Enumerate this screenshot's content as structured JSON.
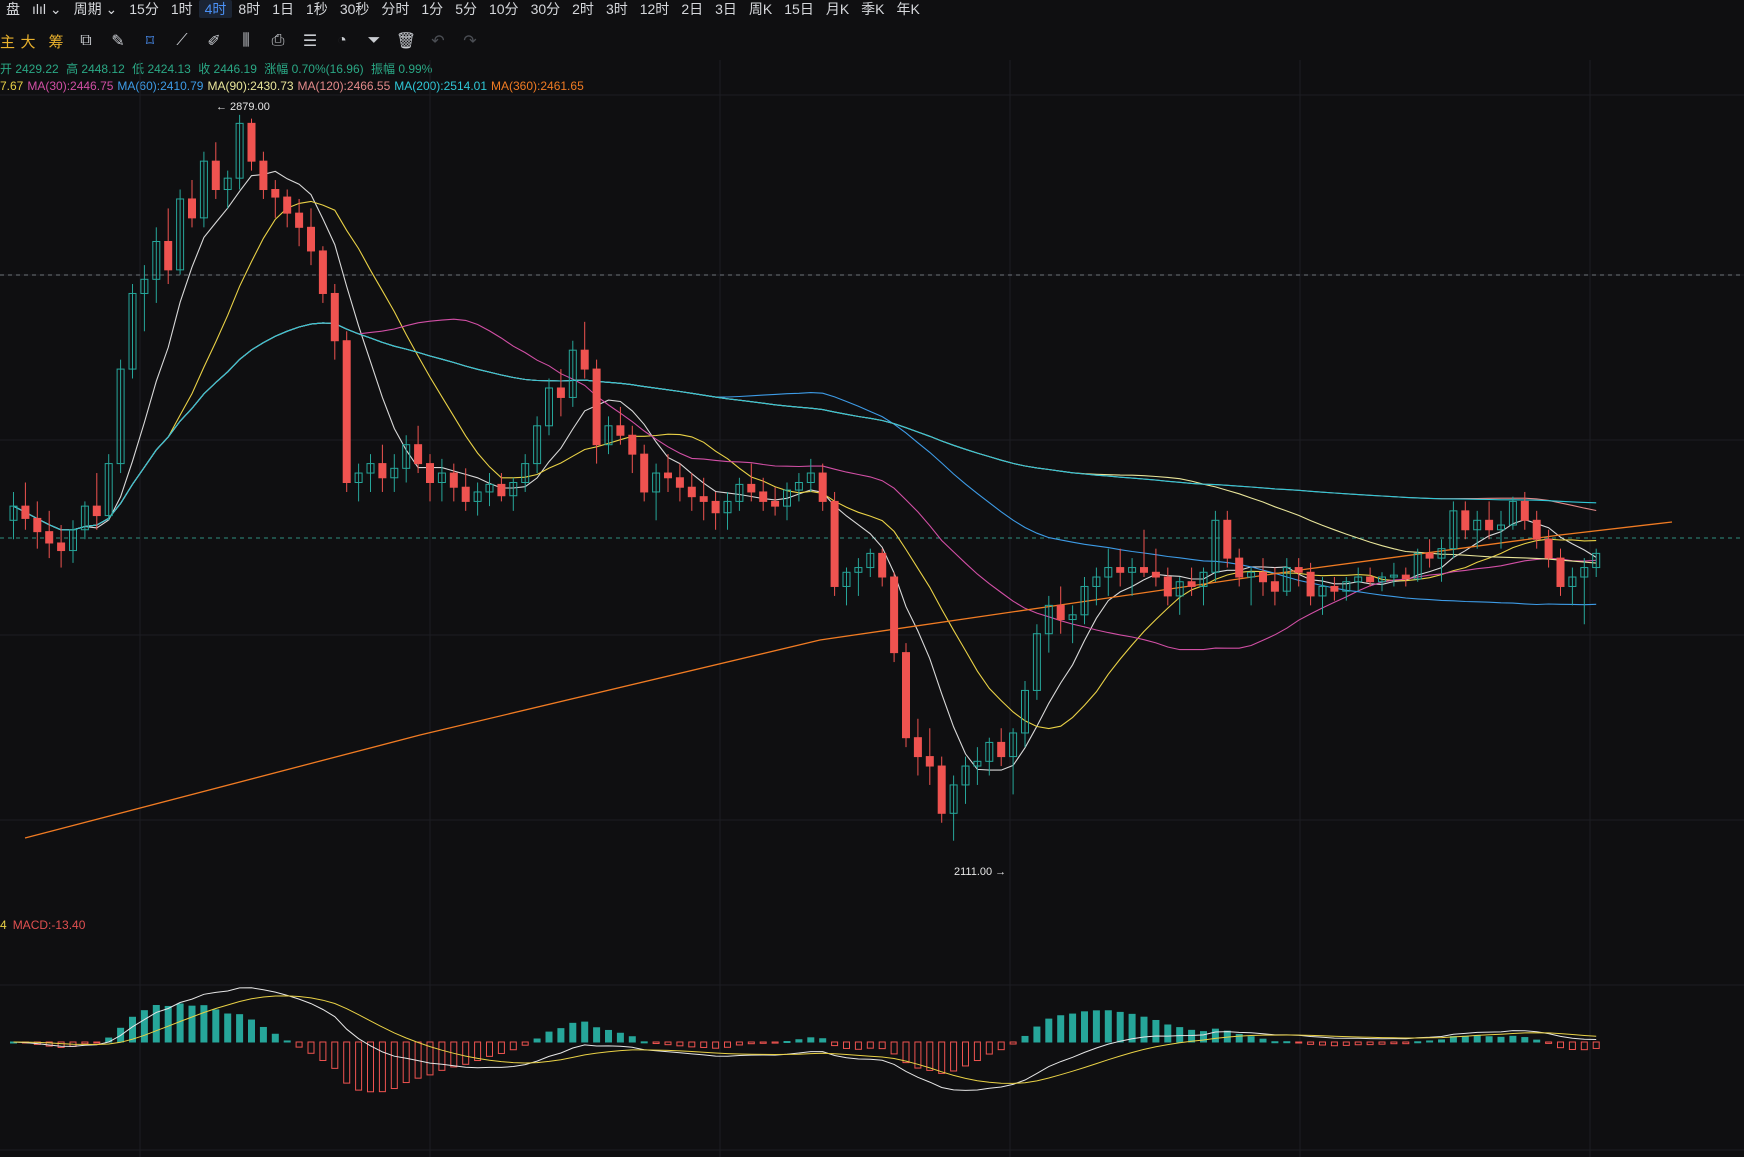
{
  "topbar": {
    "items": [
      {
        "label": "盘",
        "active": false
      },
      {
        "label": "ılıl ⌄",
        "active": false
      },
      {
        "label": "周期 ⌄",
        "active": false
      },
      {
        "label": "15分",
        "active": false
      },
      {
        "label": "1时",
        "active": false
      },
      {
        "label": "4时",
        "active": true
      },
      {
        "label": "8时",
        "active": false
      },
      {
        "label": "1日",
        "active": false
      },
      {
        "label": "1秒",
        "active": false
      },
      {
        "label": "30秒",
        "active": false
      },
      {
        "label": "分时",
        "active": false
      },
      {
        "label": "1分",
        "active": false
      },
      {
        "label": "5分",
        "active": false
      },
      {
        "label": "10分",
        "active": false
      },
      {
        "label": "30分",
        "active": false
      },
      {
        "label": "2时",
        "active": false
      },
      {
        "label": "3时",
        "active": false
      },
      {
        "label": "12时",
        "active": false
      },
      {
        "label": "2日",
        "active": false
      },
      {
        "label": "3日",
        "active": false
      },
      {
        "label": "周K",
        "active": false
      },
      {
        "label": "15日",
        "active": false
      },
      {
        "label": "月K",
        "active": false
      },
      {
        "label": "季K",
        "active": false
      },
      {
        "label": "年K",
        "active": false
      }
    ]
  },
  "toolbar": {
    "words": [
      "主",
      "大",
      "筹"
    ],
    "tools": [
      {
        "name": "crosshair-tool-icon",
        "glyph": "⧉",
        "active": false
      },
      {
        "name": "draw-tool-icon",
        "glyph": "✎",
        "active": false
      },
      {
        "name": "select-tool-icon",
        "glyph": "⌑",
        "active": true
      },
      {
        "name": "ruler-icon",
        "glyph": "⟋",
        "active": false
      },
      {
        "name": "brush-icon",
        "glyph": "✐",
        "active": false
      },
      {
        "name": "indicator-icon",
        "glyph": "⫼",
        "active": false
      },
      {
        "name": "lock-icon",
        "glyph": "⎙",
        "active": false
      },
      {
        "name": "note-icon",
        "glyph": "☰",
        "active": false
      },
      {
        "name": "magnet-icon",
        "glyph": "◔",
        "active": false
      },
      {
        "name": "filter-icon",
        "glyph": "⏷",
        "active": false
      },
      {
        "name": "trash-icon",
        "glyph": "🗑",
        "active": false
      },
      {
        "name": "undo-icon",
        "glyph": "↶",
        "active": false,
        "dim": true
      },
      {
        "name": "redo-icon",
        "glyph": "↷",
        "active": false,
        "dim": true
      }
    ]
  },
  "ohlc": {
    "open": "开 2429.22",
    "high": "高 2448.12",
    "low": "低 2424.13",
    "close": "收 2446.19",
    "change": "涨幅 0.70%(16.96)",
    "amplitude": "振幅 0.99%"
  },
  "ma_legend": [
    {
      "label": "7.67",
      "color": "#e9d146"
    },
    {
      "label": "MA(30):2446.75",
      "color": "#d14fa5"
    },
    {
      "label": "MA(60):2410.79",
      "color": "#3d9be6"
    },
    {
      "label": "MA(90):2430.73",
      "color": "#e9e59a"
    },
    {
      "label": "MA(120):2466.55",
      "color": "#e38a8a"
    },
    {
      "label": "MA(200):2514.01",
      "color": "#2fc7d6"
    },
    {
      "label": "MA(360):2461.65",
      "color": "#f07b23"
    }
  ],
  "macd_legend": [
    {
      "label": "4",
      "color": "#e9d146"
    },
    {
      "label": "MACD:-13.40",
      "color": "#e05050"
    }
  ],
  "annotations": {
    "high": "← 2879.00",
    "low": "2111.00 →"
  },
  "colors": {
    "up": "#26a69a",
    "down": "#ef5350",
    "bg": "#0f0f11",
    "grid": "#1c1e22"
  },
  "chart_data": {
    "type": "candlestick",
    "timeframe": "4时",
    "high_marker": 2879.0,
    "low_marker": 2111.0,
    "candles": [
      [
        2450,
        2480,
        2430,
        2465
      ],
      [
        2465,
        2490,
        2440,
        2452
      ],
      [
        2452,
        2470,
        2420,
        2438
      ],
      [
        2438,
        2460,
        2410,
        2426
      ],
      [
        2426,
        2445,
        2400,
        2418
      ],
      [
        2418,
        2450,
        2405,
        2440
      ],
      [
        2440,
        2470,
        2430,
        2465
      ],
      [
        2465,
        2500,
        2440,
        2455
      ],
      [
        2455,
        2520,
        2450,
        2510
      ],
      [
        2510,
        2620,
        2500,
        2610
      ],
      [
        2610,
        2700,
        2600,
        2690
      ],
      [
        2690,
        2720,
        2650,
        2705
      ],
      [
        2705,
        2760,
        2680,
        2745
      ],
      [
        2745,
        2780,
        2700,
        2715
      ],
      [
        2715,
        2800,
        2710,
        2790
      ],
      [
        2790,
        2810,
        2760,
        2770
      ],
      [
        2770,
        2840,
        2760,
        2830
      ],
      [
        2830,
        2850,
        2790,
        2800
      ],
      [
        2800,
        2820,
        2780,
        2812
      ],
      [
        2812,
        2879,
        2800,
        2870
      ],
      [
        2870,
        2875,
        2820,
        2830
      ],
      [
        2830,
        2840,
        2790,
        2800
      ],
      [
        2800,
        2810,
        2770,
        2792
      ],
      [
        2792,
        2800,
        2760,
        2775
      ],
      [
        2775,
        2790,
        2740,
        2760
      ],
      [
        2760,
        2780,
        2720,
        2735
      ],
      [
        2735,
        2740,
        2680,
        2690
      ],
      [
        2690,
        2700,
        2620,
        2640
      ],
      [
        2640,
        2650,
        2480,
        2490
      ],
      [
        2490,
        2510,
        2470,
        2500
      ],
      [
        2500,
        2520,
        2480,
        2510
      ],
      [
        2510,
        2530,
        2480,
        2495
      ],
      [
        2495,
        2520,
        2480,
        2505
      ],
      [
        2505,
        2540,
        2490,
        2530
      ],
      [
        2530,
        2550,
        2500,
        2510
      ],
      [
        2510,
        2520,
        2470,
        2490
      ],
      [
        2490,
        2515,
        2470,
        2500
      ],
      [
        2500,
        2510,
        2470,
        2485
      ],
      [
        2485,
        2505,
        2460,
        2470
      ],
      [
        2470,
        2490,
        2455,
        2480
      ],
      [
        2480,
        2500,
        2465,
        2488
      ],
      [
        2488,
        2500,
        2470,
        2476
      ],
      [
        2476,
        2495,
        2460,
        2490
      ],
      [
        2490,
        2520,
        2480,
        2510
      ],
      [
        2510,
        2560,
        2500,
        2550
      ],
      [
        2550,
        2600,
        2540,
        2590
      ],
      [
        2590,
        2610,
        2560,
        2580
      ],
      [
        2580,
        2640,
        2570,
        2630
      ],
      [
        2630,
        2660,
        2600,
        2610
      ],
      [
        2610,
        2620,
        2510,
        2530
      ],
      [
        2530,
        2560,
        2520,
        2550
      ],
      [
        2550,
        2570,
        2530,
        2540
      ],
      [
        2540,
        2550,
        2500,
        2520
      ],
      [
        2520,
        2530,
        2470,
        2480
      ],
      [
        2480,
        2510,
        2450,
        2500
      ],
      [
        2500,
        2520,
        2480,
        2495
      ],
      [
        2495,
        2510,
        2470,
        2485
      ],
      [
        2485,
        2500,
        2460,
        2475
      ],
      [
        2475,
        2495,
        2450,
        2470
      ],
      [
        2470,
        2480,
        2440,
        2458
      ],
      [
        2458,
        2480,
        2440,
        2470
      ],
      [
        2470,
        2495,
        2460,
        2488
      ],
      [
        2488,
        2510,
        2470,
        2480
      ],
      [
        2480,
        2495,
        2460,
        2470
      ],
      [
        2470,
        2485,
        2455,
        2465
      ],
      [
        2465,
        2490,
        2450,
        2482
      ],
      [
        2482,
        2500,
        2470,
        2490
      ],
      [
        2490,
        2515,
        2480,
        2500
      ],
      [
        2500,
        2510,
        2460,
        2470
      ],
      [
        2470,
        2480,
        2370,
        2380
      ],
      [
        2380,
        2400,
        2360,
        2395
      ],
      [
        2395,
        2410,
        2370,
        2400
      ],
      [
        2400,
        2420,
        2390,
        2415
      ],
      [
        2415,
        2420,
        2380,
        2390
      ],
      [
        2390,
        2395,
        2300,
        2310
      ],
      [
        2310,
        2320,
        2210,
        2220
      ],
      [
        2220,
        2240,
        2180,
        2200
      ],
      [
        2200,
        2230,
        2170,
        2190
      ],
      [
        2190,
        2200,
        2130,
        2140
      ],
      [
        2140,
        2180,
        2111,
        2170
      ],
      [
        2170,
        2200,
        2150,
        2190
      ],
      [
        2190,
        2210,
        2170,
        2195
      ],
      [
        2195,
        2220,
        2180,
        2215
      ],
      [
        2215,
        2230,
        2190,
        2200
      ],
      [
        2200,
        2230,
        2160,
        2225
      ],
      [
        2225,
        2280,
        2210,
        2270
      ],
      [
        2270,
        2340,
        2260,
        2330
      ],
      [
        2330,
        2370,
        2310,
        2360
      ],
      [
        2360,
        2380,
        2330,
        2345
      ],
      [
        2345,
        2360,
        2320,
        2350
      ],
      [
        2350,
        2390,
        2340,
        2380
      ],
      [
        2380,
        2400,
        2360,
        2390
      ],
      [
        2390,
        2420,
        2370,
        2400
      ],
      [
        2400,
        2420,
        2380,
        2395
      ],
      [
        2395,
        2410,
        2370,
        2400
      ],
      [
        2400,
        2440,
        2390,
        2395
      ],
      [
        2395,
        2420,
        2380,
        2390
      ],
      [
        2390,
        2400,
        2360,
        2370
      ],
      [
        2370,
        2390,
        2350,
        2385
      ],
      [
        2385,
        2400,
        2370,
        2380
      ],
      [
        2380,
        2400,
        2360,
        2395
      ],
      [
        2395,
        2460,
        2385,
        2450
      ],
      [
        2450,
        2460,
        2400,
        2410
      ],
      [
        2410,
        2420,
        2380,
        2390
      ],
      [
        2390,
        2400,
        2360,
        2395
      ],
      [
        2395,
        2410,
        2370,
        2385
      ],
      [
        2385,
        2400,
        2360,
        2375
      ],
      [
        2375,
        2410,
        2370,
        2400
      ],
      [
        2400,
        2410,
        2380,
        2395
      ],
      [
        2395,
        2405,
        2360,
        2370
      ],
      [
        2370,
        2390,
        2350,
        2380
      ],
      [
        2380,
        2390,
        2365,
        2375
      ],
      [
        2375,
        2390,
        2365,
        2385
      ],
      [
        2385,
        2400,
        2375,
        2390
      ],
      [
        2390,
        2400,
        2380,
        2385
      ],
      [
        2385,
        2395,
        2375,
        2390
      ],
      [
        2390,
        2405,
        2380,
        2392
      ],
      [
        2392,
        2400,
        2380,
        2388
      ],
      [
        2388,
        2420,
        2385,
        2415
      ],
      [
        2415,
        2430,
        2400,
        2410
      ],
      [
        2410,
        2430,
        2385,
        2420
      ],
      [
        2420,
        2470,
        2410,
        2460
      ],
      [
        2460,
        2470,
        2430,
        2440
      ],
      [
        2440,
        2460,
        2420,
        2450
      ],
      [
        2450,
        2470,
        2430,
        2440
      ],
      [
        2440,
        2460,
        2420,
        2445
      ],
      [
        2445,
        2475,
        2440,
        2470
      ],
      [
        2470,
        2480,
        2440,
        2450
      ],
      [
        2450,
        2460,
        2420,
        2430
      ],
      [
        2430,
        2440,
        2400,
        2410
      ],
      [
        2410,
        2420,
        2370,
        2380
      ],
      [
        2380,
        2400,
        2360,
        2390
      ],
      [
        2390,
        2410,
        2340,
        2400
      ],
      [
        2400,
        2420,
        2390,
        2415
      ]
    ]
  }
}
